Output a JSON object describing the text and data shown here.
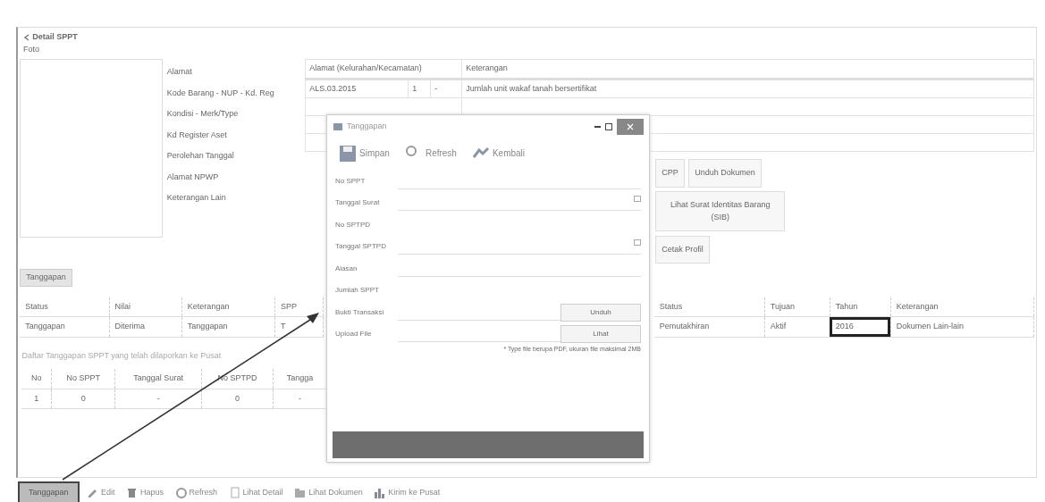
{
  "page": {
    "title": "Detail SPPT",
    "photo_label": "Foto"
  },
  "info_labels": [
    "Alamat",
    "Kode Barang - NUP - Kd. Reg",
    "Kondisi - Merk/Type",
    "Kd Register Aset",
    "Perolehan Tanggal",
    "Alamat NPWP",
    "Keterangan Lain"
  ],
  "top_table": {
    "columns": [
      "Alamat (Kelurahan/Kecamatan)",
      "Keterangan"
    ],
    "rows": [
      {
        "address_parts": [
          "ALS.03.2015",
          "1",
          "-"
        ],
        "note": "Jumlah unit wakaf tanah bersertifikat"
      }
    ]
  },
  "side_buttons": [
    "CPP",
    "Unduh Dokumen",
    "Lihat Surat Identitas Barang (SIB)",
    "Cetak Profil"
  ],
  "tabs": [
    {
      "label": "Tanggapan",
      "selected": true
    }
  ],
  "detail_table": {
    "left": {
      "columns": [
        "Status",
        "Nilai",
        "Keterangan",
        "SPP"
      ],
      "row": [
        {
          "text": "Tanggapan",
          "outlined": false
        },
        {
          "text": "Diterima",
          "outlined": false
        },
        {
          "text": "Tanggapan",
          "outlined": false
        },
        {
          "text": "T",
          "outlined": false
        }
      ]
    },
    "right": {
      "columns": [
        "Status",
        "Tujuan",
        "Tahun",
        "Keterangan"
      ],
      "row": [
        {
          "text": "Pemutakhiran",
          "outlined": false
        },
        {
          "text": "Aktif",
          "outlined": false
        },
        {
          "text": "2016",
          "outlined": true
        },
        {
          "text": "Dokumen Lain-lain",
          "outlined": false
        }
      ]
    }
  },
  "list_caption": "Daftar Tanggapan SPPT yang telah dilaporkan ke Pusat",
  "list_table": {
    "columns": [
      "No",
      "No SPPT",
      "Tanggal Surat",
      "No SPTPD",
      "Tangga"
    ],
    "rows": [
      [
        "1",
        "0",
        "-",
        "0",
        "-"
      ]
    ]
  },
  "bottom_toolbar": [
    {
      "label": "Tanggapan",
      "kind": "plain",
      "outlined": true
    },
    {
      "label": "Edit",
      "kind": "pencil",
      "outlined": false
    },
    {
      "label": "Hapus",
      "kind": "trash",
      "outlined": false
    },
    {
      "label": "Refresh",
      "kind": "refresh",
      "outlined": false
    },
    {
      "label": "Lihat Detail",
      "kind": "doc",
      "outlined": false
    },
    {
      "label": "Lihat Dokumen",
      "kind": "folder",
      "outlined": false
    },
    {
      "label": "Kirim ke Pusat",
      "kind": "chart",
      "outlined": false
    }
  ],
  "dialog": {
    "title": "Tanggapan",
    "toolbar": [
      {
        "label": "Simpan",
        "kind": "save"
      },
      {
        "label": "Refresh",
        "kind": "refresh"
      },
      {
        "label": "Kembali",
        "kind": "back"
      }
    ],
    "fields": [
      {
        "label": "No SPPT",
        "kind": "text"
      },
      {
        "label": "Tanggal Surat",
        "kind": "date"
      },
      {
        "label": "No SPTPD",
        "kind": "blank"
      },
      {
        "label": "Tanggal SPTPD",
        "kind": "date"
      },
      {
        "label": "Alasan",
        "kind": "text"
      },
      {
        "label": "Jumlah SPPT",
        "kind": "blank"
      },
      {
        "label": "Bukti Transaksi",
        "kind": "button",
        "button": "Unduh"
      },
      {
        "label": "Upload File",
        "kind": "button",
        "button": "Lihat"
      }
    ],
    "note": "* Type file berupa PDF, ukuran file maksimal 2MB"
  }
}
